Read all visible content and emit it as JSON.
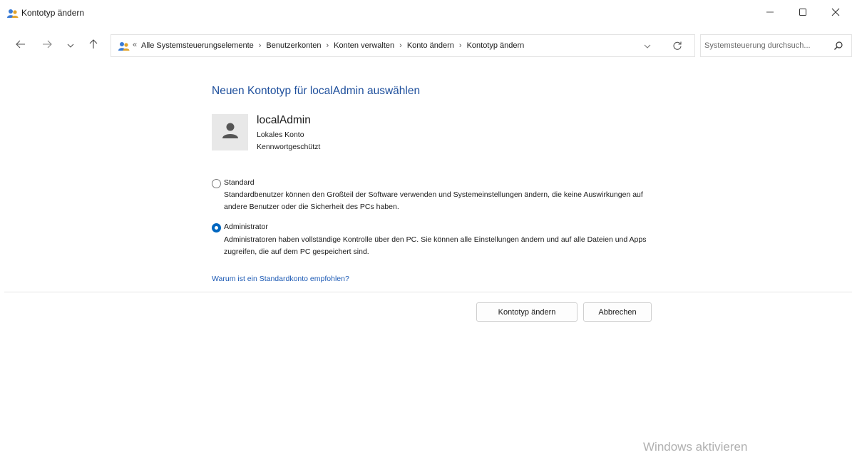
{
  "window": {
    "title": "Kontotyp ändern",
    "icon": "users-icon",
    "controls": {
      "minimize": "minimize-icon",
      "maximize": "maximize-icon",
      "close": "close-icon"
    }
  },
  "nav": {
    "buttons": [
      "back-arrow-icon",
      "forward-arrow-icon",
      "chevron-down-icon",
      "up-arrow-icon"
    ],
    "address": {
      "icon": "control-panel-icon",
      "prefix": "«",
      "crumbs": [
        "Alle Systemsteuerungselemente",
        "Benutzerkonten",
        "Konten verwalten",
        "Konto ändern",
        "Kontotyp ändern"
      ],
      "separator": "›"
    },
    "search": {
      "placeholder": "Systemsteuerung durchsuch..."
    }
  },
  "main": {
    "heading": "Neuen Kontotyp für localAdmin auswählen",
    "user": {
      "name": "localAdmin",
      "line1": "Lokales Konto",
      "line2": "Kennwortgeschützt"
    },
    "options": [
      {
        "label": "Standard",
        "selected": false,
        "desc": "Standardbenutzer können den Großteil der Software verwenden und Systemeinstellungen ändern, die keine Auswirkungen auf andere Benutzer oder die Sicherheit des PCs haben."
      },
      {
        "label": "Administrator",
        "selected": true,
        "desc": "Administratoren haben vollständige Kontrolle über den PC. Sie können alle Einstellungen ändern und auf alle Dateien und Apps zugreifen, die auf dem PC gespeichert sind."
      }
    ],
    "why_link": "Warum ist ein Standardkonto empfohlen?",
    "buttons": {
      "change": "Kontotyp ändern",
      "cancel": "Abbrechen"
    }
  },
  "watermark": "Windows aktivieren",
  "colors": {
    "heading": "#1e4f9c",
    "link": "#1e5bb5",
    "radio_selected": "#0067c0"
  }
}
